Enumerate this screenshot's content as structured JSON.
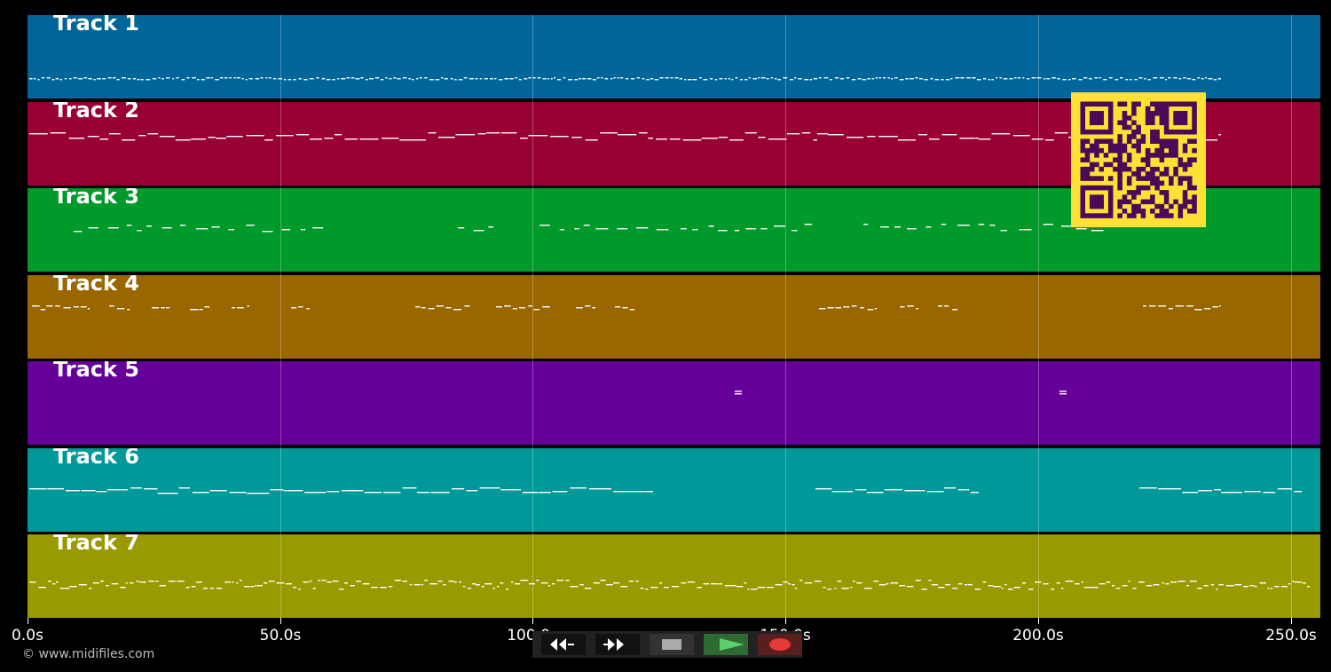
{
  "colors": {
    "background": "#000000",
    "note_color": "#ffffff",
    "qr_background": "#ffe135",
    "qr_modules": "#4a0a58",
    "button_bg": "#111111",
    "stop_color": "#aaaaaa",
    "play_bg": "#2e6b32",
    "play_color": "#5dcf6a",
    "record_bg": "#5a1e1e",
    "record_color": "#e53935"
  },
  "tracks": [
    {
      "label": "Track 1",
      "color": "#00669a"
    },
    {
      "label": "Track 2",
      "color": "#990033"
    },
    {
      "label": "Track 3",
      "color": "#009a2a"
    },
    {
      "label": "Track 4",
      "color": "#996600"
    },
    {
      "label": "Track 5",
      "color": "#650099"
    },
    {
      "label": "Track 6",
      "color": "#00999a"
    },
    {
      "label": "Track 7",
      "color": "#999a00"
    }
  ],
  "timeline": {
    "min_seconds": 0,
    "max_seconds": 256,
    "ticks": [
      {
        "value": 0,
        "label": "0.0s"
      },
      {
        "value": 50,
        "label": "50.0s"
      },
      {
        "value": 100,
        "label": "100.0s"
      },
      {
        "value": 150,
        "label": "150.0s"
      },
      {
        "value": 200,
        "label": "200.0s"
      },
      {
        "value": 250,
        "label": "250.0s"
      }
    ]
  },
  "footer": {
    "copyright": "© www.midifiles.com"
  },
  "transport": {
    "buttons": [
      {
        "name": "rewind-button",
        "icon": "rewind-icon"
      },
      {
        "name": "fast-forward-button",
        "icon": "fast-forward-icon"
      },
      {
        "name": "stop-button",
        "icon": "stop-icon"
      },
      {
        "name": "play-button",
        "icon": "play-icon"
      },
      {
        "name": "record-button",
        "icon": "record-icon"
      }
    ]
  },
  "overlay": {
    "icon": "qr-code-icon"
  }
}
